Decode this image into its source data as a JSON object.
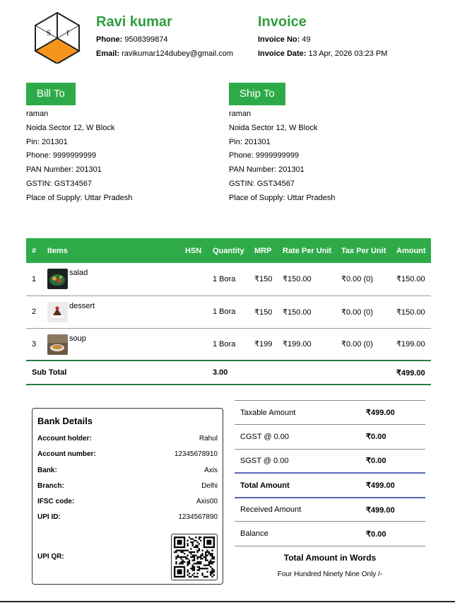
{
  "logo": {
    "letter_left": "S",
    "letter_right": "I",
    "accent": "#f7941d"
  },
  "company": {
    "name": "Ravi kumar",
    "phone_label": "Phone:",
    "phone": "9508399874",
    "email_label": "Email:",
    "email": "ravikumar124dubey@gmail.com"
  },
  "invoice": {
    "title": "Invoice",
    "no_label": "Invoice No:",
    "no": "49",
    "date_label": "Invoice Date:",
    "date": "13 Apr, 2026 03:23 PM"
  },
  "bill_to": {
    "title": "Bill To",
    "name": "raman",
    "address": "Noida Sector 12, W Block",
    "pin": "Pin: 201301",
    "phone": "Phone: 9999999999",
    "pan": "PAN Number: 201301",
    "gstin": "GSTIN: GST34567",
    "supply": "Place of Supply: Uttar Pradesh"
  },
  "ship_to": {
    "title": "Ship To",
    "name": "raman",
    "address": "Noida Sector 12, W Block",
    "pin": "Pin: 201301",
    "phone": "Phone: 9999999999",
    "pan": "PAN Number: 201301",
    "gstin": "GSTIN: GST34567",
    "supply": "Place of Supply: Uttar Pradesh"
  },
  "items_table": {
    "headers": [
      "#",
      "Items",
      "HSN",
      "Quantity",
      "MRP",
      "Rate Per Unit",
      "Tax Per Unit",
      "Amount"
    ],
    "rows": [
      {
        "no": "1",
        "name": "salad",
        "hsn": "",
        "qty": "1 Bora",
        "mrp": "₹150",
        "rate": "₹150.00",
        "tax": "₹0.00 (0)",
        "amount": "₹150.00"
      },
      {
        "no": "2",
        "name": "dessert",
        "hsn": "",
        "qty": "1 Bora",
        "mrp": "₹150",
        "rate": "₹150.00",
        "tax": "₹0.00 (0)",
        "amount": "₹150.00"
      },
      {
        "no": "3",
        "name": "soup",
        "hsn": "",
        "qty": "1 Bora",
        "mrp": "₹199",
        "rate": "₹199.00",
        "tax": "₹0.00 (0)",
        "amount": "₹199.00"
      }
    ],
    "subtotal_label": "Sub Total",
    "subtotal_qty": "3.00",
    "subtotal_amount": "₹499.00"
  },
  "bank": {
    "title": "Bank Details",
    "rows": [
      {
        "label": "Account holder:",
        "value": "Rahul"
      },
      {
        "label": "Account number:",
        "value": "12345678910"
      },
      {
        "label": "Bank:",
        "value": "Axis"
      },
      {
        "label": "Branch:",
        "value": "Delhi"
      },
      {
        "label": "IFSC code:",
        "value": "Axis00"
      },
      {
        "label": "UPI ID:",
        "value": "1234567890"
      }
    ],
    "qr_label": "UPI QR:"
  },
  "totals": {
    "rows": [
      {
        "label": "Taxable Amount",
        "value": "₹499.00"
      },
      {
        "label": "CGST @ 0.00",
        "value": "₹0.00"
      },
      {
        "label": "SGST @ 0.00",
        "value": "₹0.00"
      },
      {
        "label": "Total Amount",
        "value": "₹499.00"
      },
      {
        "label": "Received Amount",
        "value": "₹499.00"
      },
      {
        "label": "Balance",
        "value": "₹0.00"
      }
    ],
    "words_title": "Total Amount in Words",
    "words_value": "Four Hundred Ninety Nine Only /-"
  },
  "colors": {
    "brand_green": "#2e9e3e",
    "header_green": "#2eab48",
    "divider_blue": "#5b67b8"
  }
}
